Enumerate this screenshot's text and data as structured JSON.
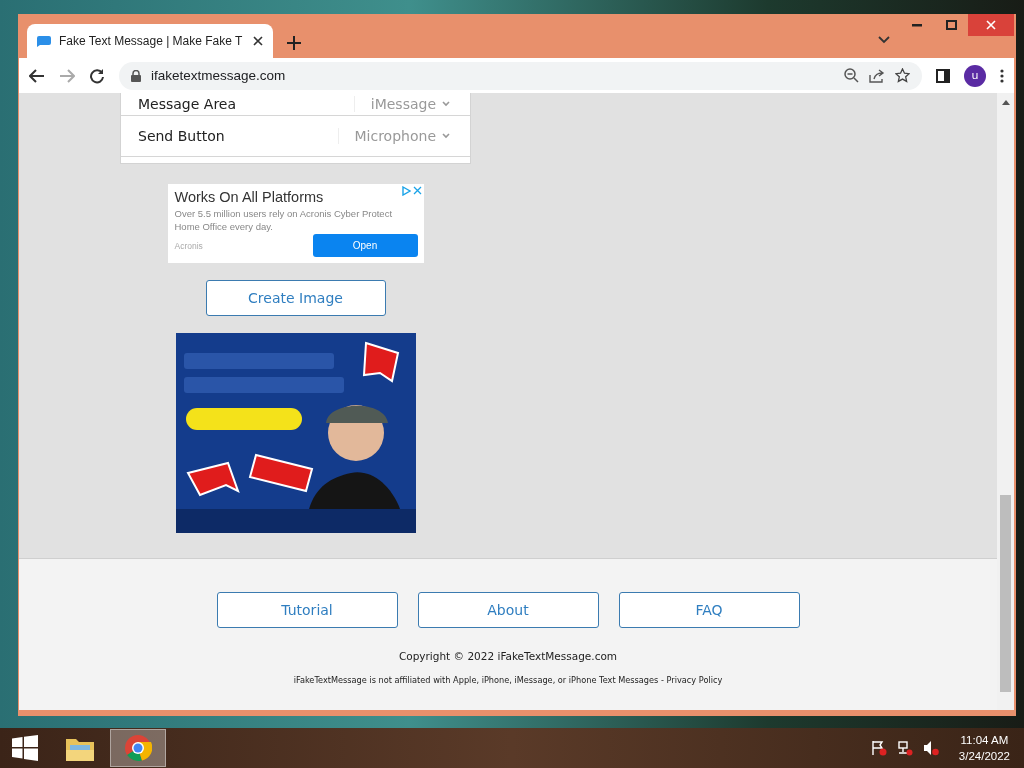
{
  "browser": {
    "tab_title": "Fake Text Message | Make Fake T",
    "url": "ifaketextmessage.com",
    "profile_initial": "u"
  },
  "settings_rows": [
    {
      "label": "Message Area",
      "value": "iMessage"
    },
    {
      "label": "Send Button",
      "value": "Microphone"
    }
  ],
  "ad_text": {
    "headline": "Works On All Platforms",
    "body": "Over 5.5 million users rely on Acronis Cyber Protect Home Office every day.",
    "advertiser": "Acronis",
    "cta": "Open"
  },
  "create_button": "Create Image",
  "footer": {
    "links": [
      "Tutorial",
      "About",
      "FAQ"
    ],
    "copyright": "Copyright © 2022 iFakeTextMessage.com",
    "disclaimer": "iFakeTextMessage is not affiliated with Apple, iPhone, iMessage, or iPhone Text Messages - ",
    "privacy": "Privacy Policy"
  },
  "taskbar": {
    "apps": [
      {
        "kind": "explorer",
        "selected": false
      },
      {
        "kind": "chrome",
        "selected": true
      }
    ],
    "time": "11:04 AM",
    "date": "3/24/2022"
  }
}
